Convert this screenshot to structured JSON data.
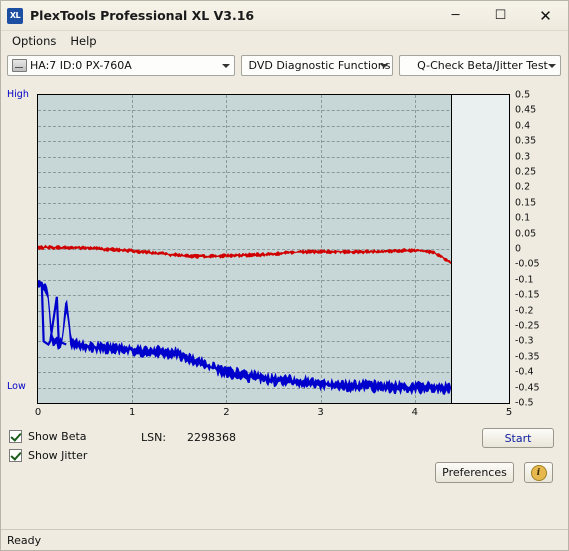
{
  "window": {
    "title": "PlexTools Professional XL V3.16",
    "icon": "app-icon",
    "minimize": "─",
    "maximize": "☐",
    "close": "✕"
  },
  "menu": {
    "items": [
      "Options",
      "Help"
    ]
  },
  "toolbar": {
    "drive": "HA:7 ID:0  PX-760A",
    "function": "DVD Diagnostic Functions",
    "test": "Q-Check Beta/Jitter Test"
  },
  "chart_labels": {
    "high": "High",
    "low": "Low"
  },
  "controls": {
    "show_beta": "Show Beta",
    "show_jitter": "Show Jitter",
    "lsn_label": "LSN:",
    "lsn_value": "2298368",
    "start": "Start",
    "preferences": "Preferences",
    "info": "i"
  },
  "status": {
    "text": "Ready"
  },
  "chart_data": {
    "type": "line",
    "title": "Q-Check Beta/Jitter Test",
    "xlabel": "",
    "ylabel": "",
    "xlim": [
      0,
      5
    ],
    "ylim": [
      -0.5,
      0.5
    ],
    "xticks": [
      0,
      1,
      2,
      3,
      4,
      5
    ],
    "yticks": [
      0.5,
      0.45,
      0.4,
      0.35,
      0.3,
      0.25,
      0.2,
      0.15,
      0.1,
      0.05,
      0,
      -0.05,
      -0.1,
      -0.15,
      -0.2,
      -0.25,
      -0.3,
      -0.35,
      -0.4,
      -0.45,
      -0.5
    ],
    "grid": true,
    "data_end_x": 4.38,
    "series": [
      {
        "name": "Beta",
        "color": "#d00000",
        "x": [
          0.0,
          0.1,
          0.2,
          0.3,
          0.4,
          0.5,
          0.6,
          0.7,
          0.8,
          0.9,
          1.0,
          1.1,
          1.2,
          1.3,
          1.4,
          1.5,
          1.6,
          1.7,
          1.8,
          1.9,
          2.0,
          2.1,
          2.2,
          2.3,
          2.4,
          2.5,
          2.6,
          2.7,
          2.8,
          2.9,
          3.0,
          3.1,
          3.2,
          3.3,
          3.4,
          3.5,
          3.6,
          3.7,
          3.8,
          3.9,
          4.0,
          4.1,
          4.2,
          4.3,
          4.38
        ],
        "y": [
          0.005,
          0.005,
          0.005,
          0.004,
          0.004,
          0.003,
          0.002,
          0.0,
          -0.002,
          -0.004,
          -0.006,
          -0.009,
          -0.012,
          -0.015,
          -0.018,
          -0.02,
          -0.023,
          -0.024,
          -0.024,
          -0.023,
          -0.022,
          -0.021,
          -0.02,
          -0.019,
          -0.018,
          -0.016,
          -0.013,
          -0.011,
          -0.01,
          -0.009,
          -0.009,
          -0.009,
          -0.009,
          -0.009,
          -0.009,
          -0.009,
          -0.008,
          -0.007,
          -0.006,
          -0.005,
          -0.004,
          -0.006,
          -0.012,
          -0.028,
          -0.045
        ]
      },
      {
        "name": "Jitter",
        "color": "#0000cc",
        "x": [
          0.0,
          0.05,
          0.1,
          0.15,
          0.2,
          0.25,
          0.3,
          0.35,
          0.4,
          0.5,
          0.6,
          0.7,
          0.8,
          0.9,
          1.0,
          1.1,
          1.2,
          1.3,
          1.4,
          1.5,
          1.6,
          1.7,
          1.8,
          1.9,
          2.0,
          2.1,
          2.2,
          2.3,
          2.4,
          2.5,
          2.6,
          2.7,
          2.8,
          2.9,
          3.0,
          3.1,
          3.2,
          3.3,
          3.4,
          3.5,
          3.6,
          3.7,
          3.8,
          3.9,
          4.0,
          4.1,
          4.2,
          4.3,
          4.38
        ],
        "y": [
          -0.115,
          -0.12,
          -0.135,
          -0.3,
          -0.305,
          -0.31,
          -0.175,
          -0.305,
          -0.31,
          -0.315,
          -0.318,
          -0.32,
          -0.322,
          -0.325,
          -0.327,
          -0.33,
          -0.332,
          -0.335,
          -0.337,
          -0.34,
          -0.355,
          -0.365,
          -0.38,
          -0.39,
          -0.4,
          -0.405,
          -0.41,
          -0.415,
          -0.42,
          -0.425,
          -0.428,
          -0.43,
          -0.432,
          -0.435,
          -0.437,
          -0.44,
          -0.442,
          -0.443,
          -0.444,
          -0.445,
          -0.446,
          -0.447,
          -0.448,
          -0.449,
          -0.45,
          -0.45,
          -0.451,
          -0.452,
          -0.452
        ]
      }
    ]
  }
}
